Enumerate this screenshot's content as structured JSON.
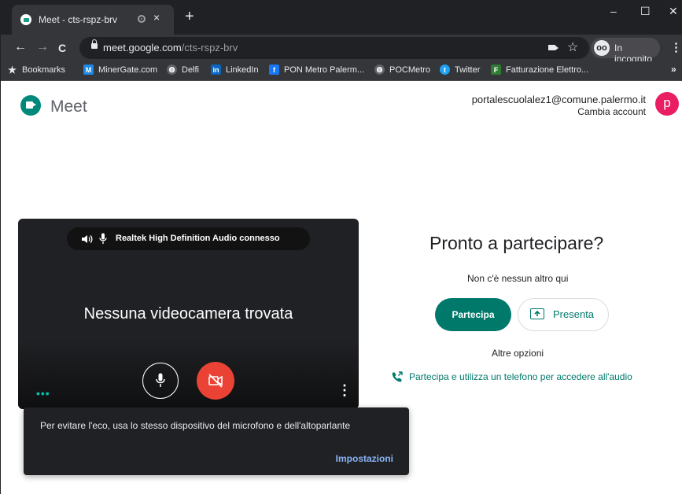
{
  "browser": {
    "tab": {
      "title": "Meet - cts-rspz-brv",
      "close": "×"
    },
    "new_tab": "+",
    "window_controls": {
      "minimize": "–",
      "maximize": "☐",
      "close": "✕"
    },
    "nav": {
      "back": "←",
      "forward": "→",
      "reload": "C"
    },
    "url": {
      "host": "meet.google.com",
      "path": "/cts-rspz-brv"
    },
    "star": "☆",
    "incognito": {
      "icon_glyph": "oo",
      "label": "In incognito"
    },
    "menu": "⋮",
    "bookmarks": [
      {
        "label": "Bookmarks",
        "icon": "star-icon",
        "glyph": "★",
        "color": "#e8eaed"
      },
      {
        "label": "MinerGate.com",
        "icon": "minergate-icon",
        "glyph": "M",
        "color": "#1e88e5"
      },
      {
        "label": "Delfi",
        "icon": "globe-icon",
        "glyph": "◍",
        "color": "#5f6368"
      },
      {
        "label": "LinkedIn",
        "icon": "linkedin-icon",
        "glyph": "in",
        "color": "#0a66c2"
      },
      {
        "label": "PON Metro Palerm...",
        "icon": "facebook-icon",
        "glyph": "f",
        "color": "#1877f2"
      },
      {
        "label": "POCMetro",
        "icon": "globe-icon",
        "glyph": "◍",
        "color": "#5f6368"
      },
      {
        "label": "Twitter",
        "icon": "twitter-icon",
        "glyph": "t",
        "color": "#1da1f2"
      },
      {
        "label": "Fatturazione Elettro...",
        "icon": "fatturazione-icon",
        "glyph": "F",
        "color": "#2e7d32"
      }
    ],
    "bookmarks_more": "»"
  },
  "meet": {
    "title": "Meet",
    "account": {
      "email": "portalescuolalez1@comune.palermo.it",
      "switch": "Cambia account",
      "avatar_letter": "p"
    },
    "preview": {
      "audio_device": "Realtek High Definition Audio  connesso",
      "no_camera": "Nessuna videocamera trovata",
      "more_dots": "•••",
      "options_dots": "⋮"
    },
    "join": {
      "title": "Pronto a partecipare?",
      "status": "Non c'è nessun altro qui",
      "join_button": "Partecipa",
      "present_button": "Presenta",
      "other_options": "Altre opzioni",
      "phone_option": "Partecipa e utilizza un telefono per accedere all'audio"
    },
    "toast": {
      "message": "Per evitare l'eco, usa lo stesso dispositivo del microfono e dell'altoparlante",
      "action": "Impostazioni"
    }
  },
  "colors": {
    "accent": "#00796b",
    "danger": "#ea4335",
    "avatar": "#e91e63",
    "link": "#8ab4f8"
  }
}
